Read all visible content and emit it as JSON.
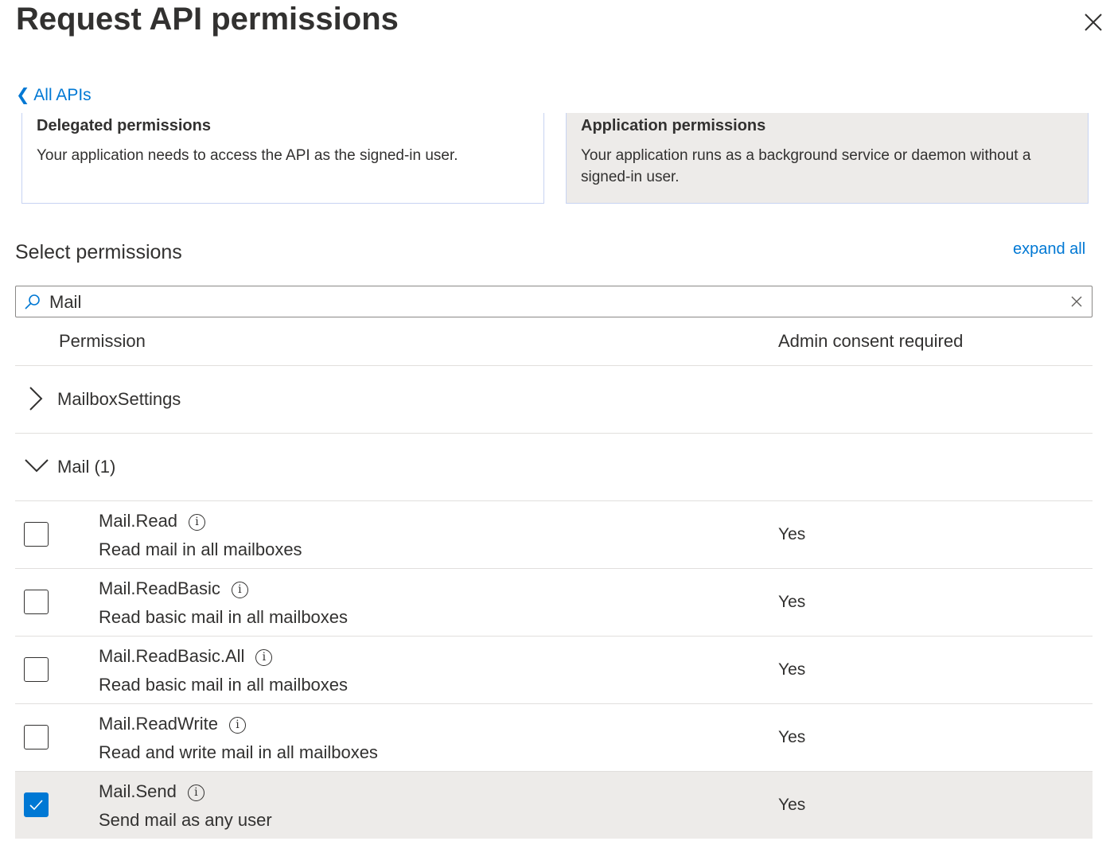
{
  "title": "Request API permissions",
  "back_link": "All APIs",
  "permission_types": [
    {
      "title": "Delegated permissions",
      "description": "Your application needs to access the API as the signed-in user.",
      "selected": false
    },
    {
      "title": "Application permissions",
      "description": "Your application runs as a background service or daemon without a signed-in user.",
      "selected": true
    }
  ],
  "select_permissions_label": "Select permissions",
  "expand_all": "expand all",
  "search": {
    "value": "Mail"
  },
  "table": {
    "col_permission": "Permission",
    "col_admin": "Admin consent required"
  },
  "groups": [
    {
      "label": "MailboxSettings",
      "expanded": false
    },
    {
      "label": "Mail (1)",
      "expanded": true
    }
  ],
  "rows": [
    {
      "name": "Mail.Read",
      "description": "Read mail in all mailboxes",
      "admin": "Yes",
      "checked": false
    },
    {
      "name": "Mail.ReadBasic",
      "description": "Read basic mail in all mailboxes",
      "admin": "Yes",
      "checked": false
    },
    {
      "name": "Mail.ReadBasic.All",
      "description": "Read basic mail in all mailboxes",
      "admin": "Yes",
      "checked": false
    },
    {
      "name": "Mail.ReadWrite",
      "description": "Read and write mail in all mailboxes",
      "admin": "Yes",
      "checked": false
    },
    {
      "name": "Mail.Send",
      "description": "Send mail as any user",
      "admin": "Yes",
      "checked": true
    }
  ],
  "colors": {
    "accent": "#0078d4",
    "selected_bg": "#edebe9"
  }
}
